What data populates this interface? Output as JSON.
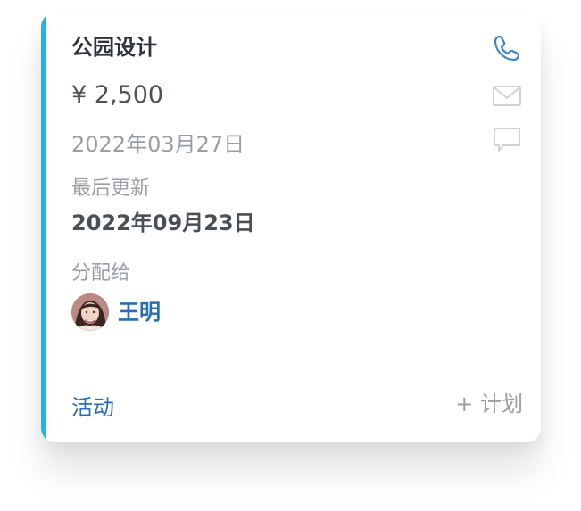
{
  "card": {
    "title": "公园设计",
    "amount": "¥ 2,500",
    "date": "2022年03月27日",
    "updated_label": "最后更新",
    "updated_value": "2022年09月23日",
    "assigned_label": "分配给",
    "assignee_name": "王明",
    "activity_label": "活动",
    "plan_label": "+ 计划"
  },
  "icons": {
    "phone": "phone-icon",
    "mail": "mail-icon",
    "comment": "comment-icon"
  },
  "colors": {
    "accent": "#27b2df",
    "link": "#2a6db3",
    "muted": "#9a9ea5",
    "title": "#2f333a",
    "icon_active": "#3f86c9",
    "icon_inactive": "#cfd2d6"
  }
}
